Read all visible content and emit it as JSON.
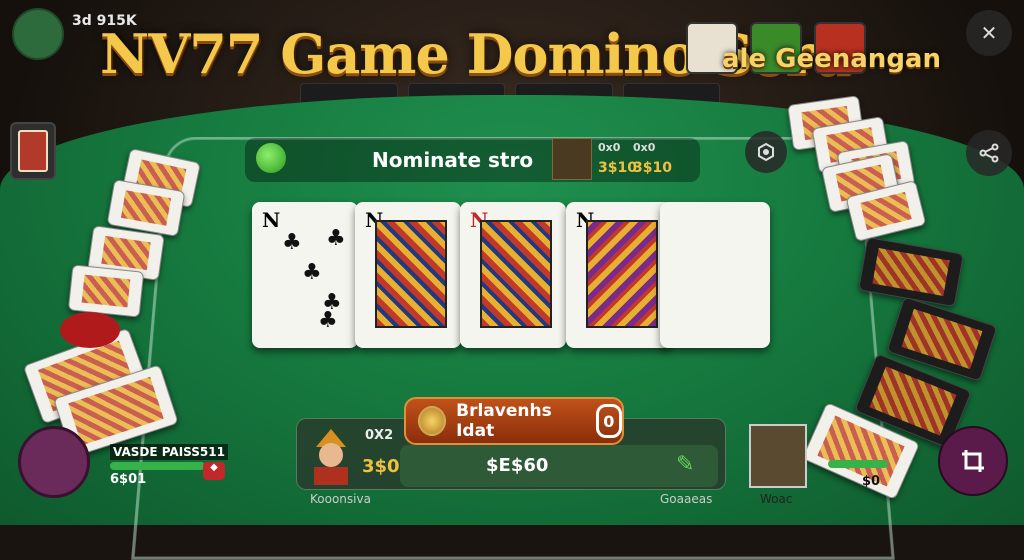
{
  "header": {
    "status_text": "3d 915K",
    "title": "NV77 Game Domino Seru",
    "subtitle": "ale Geenangan"
  },
  "info_bar": {
    "text": "Nominate stro",
    "nums": [
      {
        "label": "0x0",
        "value": "3$10"
      },
      {
        "label": "0x0",
        "value": "3$10"
      }
    ]
  },
  "table_cards": [
    {
      "rank": "N",
      "suit": "♣",
      "color": "#111"
    },
    {
      "rank": "N",
      "suit": "♣",
      "color": "#111"
    },
    {
      "rank": "N",
      "suit": "♥",
      "color": "#c0282a"
    },
    {
      "rank": "N",
      "suit": "♣",
      "color": "#111"
    },
    {
      "rank": "",
      "suit": "",
      "color": "#111"
    }
  ],
  "action_button": {
    "label": "Brlavenhs Idat",
    "value": "0"
  },
  "player_panel": {
    "label": "0X2",
    "value": "3$0",
    "score": "$E$60"
  },
  "bottom_left_player": {
    "label": "VASDE PAISS511",
    "value": "6$01"
  },
  "bottom_right_player": {
    "value": "$0"
  },
  "below_labels": {
    "left": "Kooonsiva",
    "center": "Goaaeas",
    "right": "Woac"
  },
  "icons": {
    "expand": "crosshair-arrows-icon",
    "share": "share-icon",
    "settings": "settings-icon",
    "crop": "crop-icon"
  }
}
